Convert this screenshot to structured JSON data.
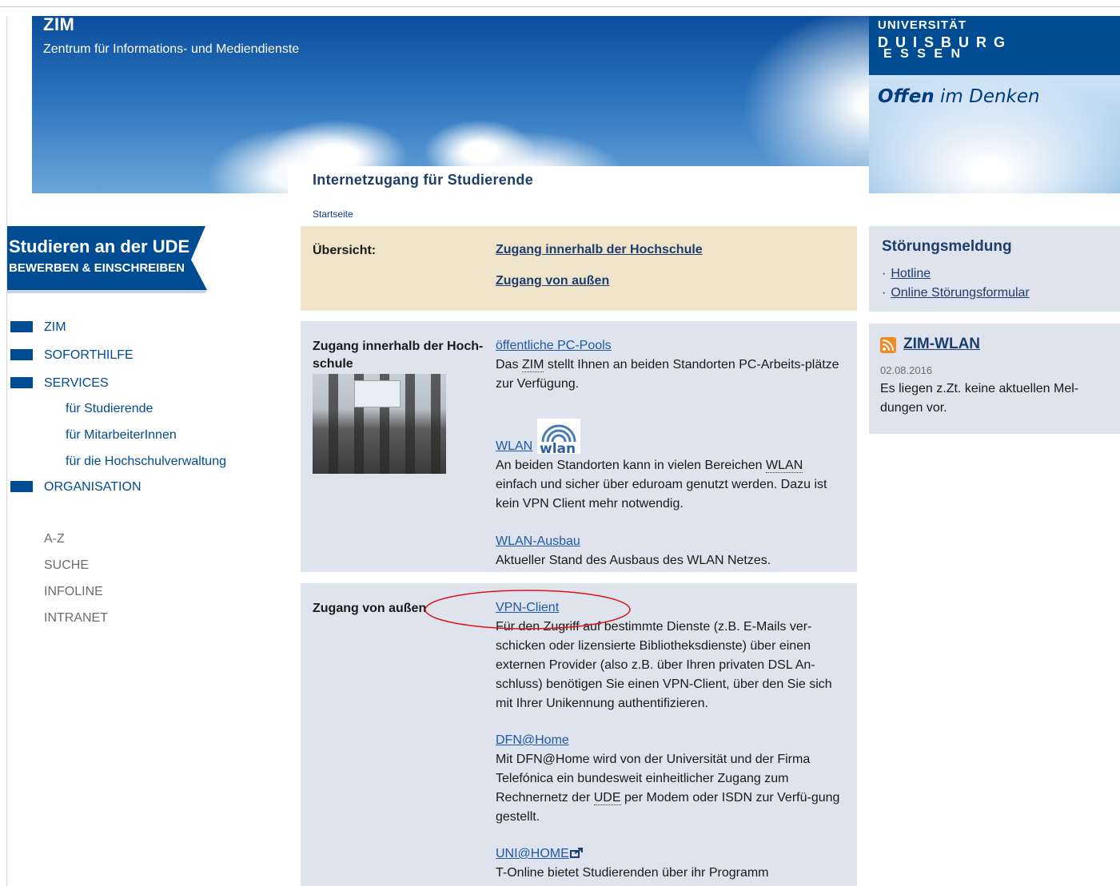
{
  "header": {
    "zim_title": "ZIM",
    "zim_subtitle": "Zentrum für Informations- und Mediendienste",
    "university_label": "UNIVERSITÄT",
    "university_name_line1": "D U I S B U R G",
    "university_name_line2": "E S S E N",
    "slogan_bold": "Offen",
    "slogan_rest": " im Denken",
    "page_title": "Internetzugang für Studierende",
    "breadcrumb": "Startseite"
  },
  "banner": {
    "line1": "Studieren an der UDE",
    "line2": "BEWERBEN & EINSCHREIBEN"
  },
  "nav": {
    "items": [
      "ZIM",
      "SOFORTHILFE",
      "SERVICES"
    ],
    "services_sub": [
      "für Studierende",
      "für MitarbeiterInnen",
      "für die Hochschulverwaltung"
    ],
    "organisation": "ORGANISATION",
    "utility": [
      "A-Z",
      "SUCHE",
      "INFOLINE",
      "INTRANET"
    ]
  },
  "overview": {
    "label": "Übersicht:",
    "link1": "Zugang innerhalb der Hochschule",
    "link2": "Zugang von außen"
  },
  "inner": {
    "label_line1": "Zugang innerhalb der Hoch-",
    "label_line2": "schule",
    "pcpools_link": "öffentliche PC-Pools",
    "pcpools_text_pre": "Das ",
    "pcpools_text_abbr": "ZIM",
    "pcpools_text_post": " stellt Ihnen an beiden Standorten PC-Arbeits-plätze zur Verfügung.",
    "wlan_link": "WLAN",
    "wlan_text_pre": "An beiden Standorten kann in vielen Bereichen ",
    "wlan_text_abbr": "WLAN",
    "wlan_text_post": " einfach und sicher über eduroam genutzt werden. Dazu ist kein VPN Client mehr notwendig.",
    "ausbau_link": "WLAN-Ausbau",
    "ausbau_text": "Aktueller Stand des Ausbaus des WLAN Netzes."
  },
  "outer": {
    "label": "Zugang von außen",
    "vpn_link": "VPN-Client",
    "vpn_text": "Für den Zugriff auf bestimmte Dienste (z.B. E-Mails ver-schicken oder lizensierte Bibliotheksdienste) über einen externen Provider (also z.B. über Ihren privaten DSL An-schluss) benötigen Sie einen VPN-Client, über den Sie sich mit  Ihrer Unikennung authentifizieren.",
    "dfn_link": "DFN@Home",
    "dfn_text_pre": "Mit DFN@Home wird von der Universität und der Firma Telefónica ein bundesweit einheitlicher Zugang zum Rechnernetz der ",
    "dfn_text_abbr": "UDE",
    "dfn_text_post": " per Modem oder ISDN zur Verfü-gung gestellt.",
    "unihome_link": "UNI@HOME",
    "unihome_text": "T-Online bietet Studierenden über ihr Programm UNI@HOME 'Surfen zum Studententarif"
  },
  "right": {
    "stoerung_title": "Störungsmeldung",
    "stoerung_links": [
      "Hotline",
      "Online Störungsformular"
    ],
    "wlan_feed_title": "ZIM-WLAN",
    "wlan_feed_date": "02.08.2016",
    "wlan_feed_text": "Es liegen z.Zt. keine aktuellen Mel-dungen vor."
  },
  "colors": {
    "ude_blue": "#004c93",
    "link_blue": "#1f58a8",
    "overview_bg": "#efe4c9",
    "box_bg": "#dee3ed",
    "annotation_red": "#d9151b"
  }
}
